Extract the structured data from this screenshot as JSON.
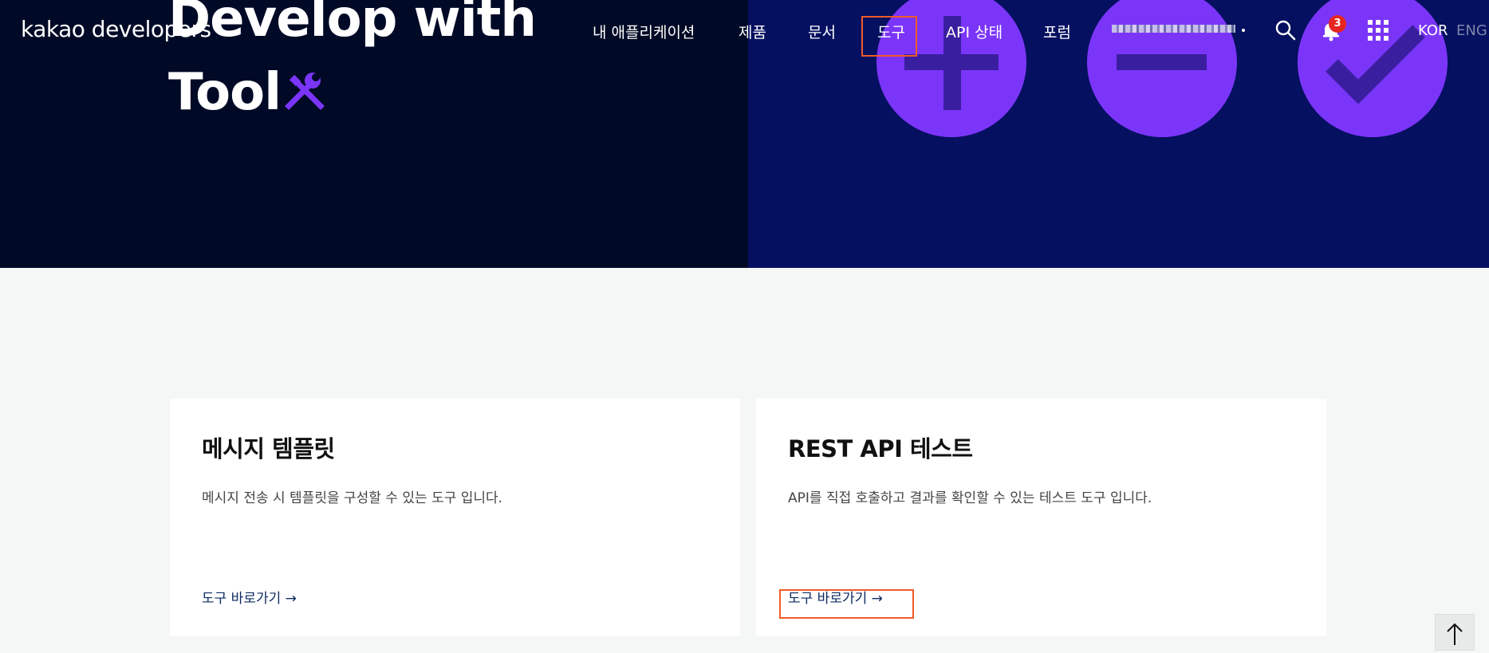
{
  "logo": {
    "text": "kakao developers"
  },
  "hero": {
    "title_line1": "Develop with",
    "title_line2": "Tool",
    "icons": [
      "wrench-icon",
      "plus-icon",
      "minus-icon",
      "check-icon"
    ],
    "colors": {
      "left_bg": "#000a26",
      "right_bg": "#051060",
      "accent": "#7b35f9"
    }
  },
  "nav": {
    "items": [
      {
        "label": "내 애플리케이션"
      },
      {
        "label": "제품"
      },
      {
        "label": "문서"
      },
      {
        "label": "도구"
      },
      {
        "label": "API 상태"
      },
      {
        "label": "포럼"
      }
    ],
    "notification_count": "3",
    "lang_kor": "KOR",
    "lang_eng": "ENG"
  },
  "cards": [
    {
      "title": "메시지 템플릿",
      "description": "메시지 전송 시 템플릿을 구성할 수 있는 도구 입니다.",
      "link": "도구 바로가기 →"
    },
    {
      "title": "REST API 테스트",
      "description": "API를 직접 호출하고 결과를 확인할 수 있는 테스트 도구 입니다.",
      "link": "도구 바로가기 →"
    }
  ]
}
